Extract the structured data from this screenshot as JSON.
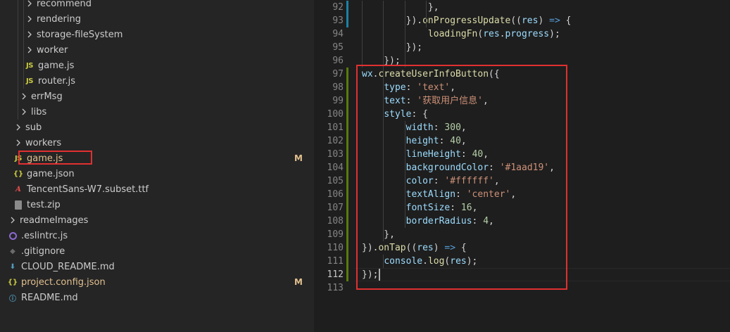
{
  "explorer": {
    "items": [
      {
        "label": "recommend",
        "kind": "folder",
        "depth": 3
      },
      {
        "label": "rendering",
        "kind": "folder",
        "depth": 3
      },
      {
        "label": "storage-fileSystem",
        "kind": "folder",
        "depth": 3
      },
      {
        "label": "worker",
        "kind": "folder",
        "depth": 3
      },
      {
        "label": "game.js",
        "kind": "js",
        "depth": 3,
        "icon_text": "JS"
      },
      {
        "label": "router.js",
        "kind": "js",
        "depth": 3,
        "icon_text": "JS"
      },
      {
        "label": "errMsg",
        "kind": "folder",
        "depth": 2
      },
      {
        "label": "libs",
        "kind": "folder",
        "depth": 2
      },
      {
        "label": "sub",
        "kind": "folder",
        "depth": 1
      },
      {
        "label": "workers",
        "kind": "folder",
        "depth": 1
      },
      {
        "label": "game.js",
        "kind": "js",
        "depth": 1,
        "icon_text": "JS",
        "badge": "M",
        "modified": true
      },
      {
        "label": "game.json",
        "kind": "json",
        "depth": 1,
        "icon_text": "{}"
      },
      {
        "label": "TencentSans-W7.subset.ttf",
        "kind": "font",
        "depth": 1,
        "icon_text": "A"
      },
      {
        "label": "test.zip",
        "kind": "zip",
        "depth": 1
      },
      {
        "label": "readmeImages",
        "kind": "folder",
        "depth": 0
      },
      {
        "label": ".eslintrc.js",
        "kind": "eslint",
        "depth": 0
      },
      {
        "label": ".gitignore",
        "kind": "git",
        "depth": 0
      },
      {
        "label": "CLOUD_README.md",
        "kind": "cloud",
        "depth": 0
      },
      {
        "label": "project.config.json",
        "kind": "json",
        "depth": 0,
        "icon_text": "{}",
        "badge": "M",
        "modified": true
      },
      {
        "label": "README.md",
        "kind": "readme",
        "depth": 0,
        "icon_text": "ⓘ"
      }
    ]
  },
  "editor": {
    "lines": [
      {
        "n": "92",
        "tokens": [
          [
            "pun",
            "            },"
          ]
        ],
        "gutter": "modified"
      },
      {
        "n": "93",
        "tokens": [
          [
            "pun",
            "        })."
          ],
          [
            "fn",
            "onProgressUpdate"
          ],
          [
            "pun",
            "(("
          ],
          [
            "var",
            "res"
          ],
          [
            "pun",
            ") "
          ],
          [
            "kw",
            "=>"
          ],
          [
            "pun",
            " {"
          ]
        ],
        "gutter": "modified"
      },
      {
        "n": "94",
        "tokens": [
          [
            "pun",
            "            "
          ],
          [
            "fn",
            "loadingFn"
          ],
          [
            "pun",
            "("
          ],
          [
            "var",
            "res"
          ],
          [
            "pun",
            "."
          ],
          [
            "var",
            "progress"
          ],
          [
            "pun",
            ");"
          ]
        ]
      },
      {
        "n": "95",
        "tokens": [
          [
            "pun",
            "        });"
          ]
        ]
      },
      {
        "n": "96",
        "tokens": [
          [
            "pun",
            "    });"
          ]
        ]
      },
      {
        "n": "97",
        "tokens": [
          [
            "var",
            "wx"
          ],
          [
            "pun",
            "."
          ],
          [
            "fn",
            "createUserInfoButton"
          ],
          [
            "pun",
            "({"
          ]
        ],
        "gutter": "added"
      },
      {
        "n": "98",
        "tokens": [
          [
            "pun",
            "    "
          ],
          [
            "var",
            "type"
          ],
          [
            "pun",
            ": "
          ],
          [
            "str",
            "'text'"
          ],
          [
            "pun",
            ","
          ]
        ],
        "gutter": "added"
      },
      {
        "n": "99",
        "tokens": [
          [
            "pun",
            "    "
          ],
          [
            "var",
            "text"
          ],
          [
            "pun",
            ": "
          ],
          [
            "str",
            "'获取用户信息'"
          ],
          [
            "pun",
            ","
          ]
        ],
        "gutter": "added"
      },
      {
        "n": "100",
        "tokens": [
          [
            "pun",
            "    "
          ],
          [
            "var",
            "style"
          ],
          [
            "pun",
            ": {"
          ]
        ],
        "gutter": "added"
      },
      {
        "n": "101",
        "tokens": [
          [
            "pun",
            "        "
          ],
          [
            "var",
            "width"
          ],
          [
            "pun",
            ": "
          ],
          [
            "num",
            "300"
          ],
          [
            "pun",
            ","
          ]
        ],
        "gutter": "added"
      },
      {
        "n": "102",
        "tokens": [
          [
            "pun",
            "        "
          ],
          [
            "var",
            "height"
          ],
          [
            "pun",
            ": "
          ],
          [
            "num",
            "40"
          ],
          [
            "pun",
            ","
          ]
        ],
        "gutter": "added"
      },
      {
        "n": "103",
        "tokens": [
          [
            "pun",
            "        "
          ],
          [
            "var",
            "lineHeight"
          ],
          [
            "pun",
            ": "
          ],
          [
            "num",
            "40"
          ],
          [
            "pun",
            ","
          ]
        ],
        "gutter": "added"
      },
      {
        "n": "104",
        "tokens": [
          [
            "pun",
            "        "
          ],
          [
            "var",
            "backgroundColor"
          ],
          [
            "pun",
            ": "
          ],
          [
            "str",
            "'#1aad19'"
          ],
          [
            "pun",
            ","
          ]
        ],
        "gutter": "added"
      },
      {
        "n": "105",
        "tokens": [
          [
            "pun",
            "        "
          ],
          [
            "var",
            "color"
          ],
          [
            "pun",
            ": "
          ],
          [
            "str",
            "'#ffffff'"
          ],
          [
            "pun",
            ","
          ]
        ],
        "gutter": "added"
      },
      {
        "n": "106",
        "tokens": [
          [
            "pun",
            "        "
          ],
          [
            "var",
            "textAlign"
          ],
          [
            "pun",
            ": "
          ],
          [
            "str",
            "'center'"
          ],
          [
            "pun",
            ","
          ]
        ],
        "gutter": "added"
      },
      {
        "n": "107",
        "tokens": [
          [
            "pun",
            "        "
          ],
          [
            "var",
            "fontSize"
          ],
          [
            "pun",
            ": "
          ],
          [
            "num",
            "16"
          ],
          [
            "pun",
            ","
          ]
        ],
        "gutter": "added"
      },
      {
        "n": "108",
        "tokens": [
          [
            "pun",
            "        "
          ],
          [
            "var",
            "borderRadius"
          ],
          [
            "pun",
            ": "
          ],
          [
            "num",
            "4"
          ],
          [
            "pun",
            ","
          ]
        ],
        "gutter": "added"
      },
      {
        "n": "109",
        "tokens": [
          [
            "pun",
            "    },"
          ]
        ],
        "gutter": "added"
      },
      {
        "n": "110",
        "tokens": [
          [
            "pun",
            "})."
          ],
          [
            "fn",
            "onTap"
          ],
          [
            "pun",
            "(("
          ],
          [
            "var",
            "res"
          ],
          [
            "pun",
            ") "
          ],
          [
            "kw",
            "=>"
          ],
          [
            "pun",
            " {"
          ]
        ],
        "gutter": "added"
      },
      {
        "n": "111",
        "tokens": [
          [
            "pun",
            "    "
          ],
          [
            "var",
            "console"
          ],
          [
            "pun",
            "."
          ],
          [
            "fn",
            "log"
          ],
          [
            "pun",
            "("
          ],
          [
            "var",
            "res"
          ],
          [
            "pun",
            ");"
          ]
        ],
        "gutter": "added"
      },
      {
        "n": "112",
        "tokens": [
          [
            "pun",
            "});"
          ]
        ],
        "gutter": "added",
        "current": true
      },
      {
        "n": "113",
        "tokens": []
      }
    ]
  },
  "colors": {
    "modified_gutter": "#1b81a8",
    "added_gutter": "#587c0c",
    "highlight_box": "#e03030",
    "git_modified": "#e2c08d"
  }
}
